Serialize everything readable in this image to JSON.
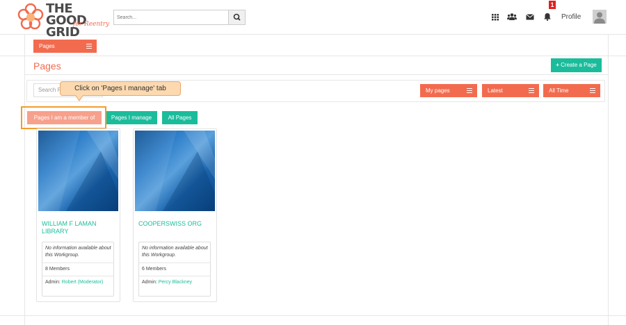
{
  "header": {
    "logo_text_line1": "THE GOOD",
    "logo_text_line2": "GRID",
    "logo_sub": "for Reentry",
    "search_placeholder": "Search...",
    "profile_label": "Profile",
    "notification_count": "1"
  },
  "subnav": {
    "pages_label": "Pages"
  },
  "page": {
    "title": "Pages",
    "create_label": "Create a Page"
  },
  "filters": {
    "search_placeholder": "Search P",
    "my_pages": "My pages",
    "latest": "Latest",
    "all_time": "All Time"
  },
  "tooltip": {
    "text": "Click on 'Pages I manage' tab"
  },
  "tabs": [
    {
      "label": "Pages I am a member of"
    },
    {
      "label": "Pages I manage"
    },
    {
      "label": "All Pages"
    }
  ],
  "cards": [
    {
      "title": "WILLIAM F LAMAN LIBRARY",
      "description": "No information available about this Workgroup.",
      "members": "8 Members",
      "admin_prefix": "Admin:",
      "admin_name": "Robert (Moderator)"
    },
    {
      "title": "COOPERSWISS ORG",
      "description": "No information available about this Workgroup.",
      "members": "6 Members",
      "admin_prefix": "Admin:",
      "admin_name": "Percy Blackney"
    }
  ],
  "colors": {
    "accent_orange": "#f26b4f",
    "accent_teal": "#1bbc9b",
    "highlight": "#f39c2b"
  }
}
